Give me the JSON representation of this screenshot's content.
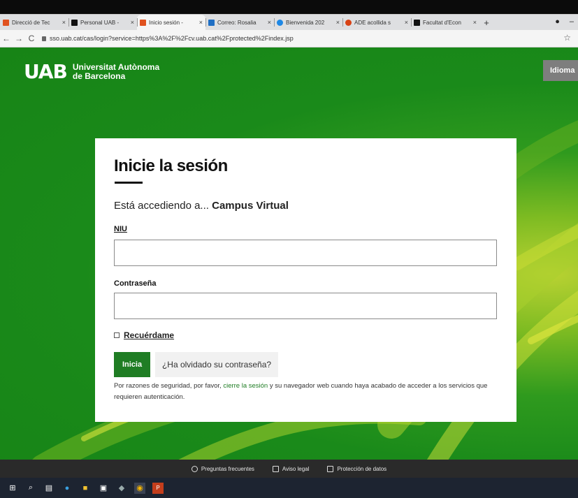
{
  "browser": {
    "tabs": [
      {
        "title": "Direcció de Tec",
        "favicon_color": "#e0521f"
      },
      {
        "title": "Personal UAB -",
        "favicon_color": "#111111"
      },
      {
        "title": "Inicio sesión - ",
        "favicon_color": "#e0521f",
        "active": true
      },
      {
        "title": "Correo: Rosalia",
        "favicon_color": "#1f6fc4"
      },
      {
        "title": "Bienvenida 202",
        "favicon_color": "#1e88e5"
      },
      {
        "title": "ADE acollida s",
        "favicon_color": "#d84315"
      },
      {
        "title": "Facultat d'Econ",
        "favicon_color": "#111111"
      }
    ],
    "tab_close": "×",
    "new_tab": "+",
    "url": "sso.uab.cat/cas/login?service=https%3A%2F%2Fcv.uab.cat%2Fprotected%2Findex.jsp"
  },
  "header": {
    "logo_text": "UAB",
    "university_line1": "Universitat Autònoma",
    "university_line2": "de Barcelona",
    "language_button": "Idioma"
  },
  "login": {
    "title": "Inicie la sesión",
    "access_prefix": "Está accediendo a...",
    "access_service": "Campus Virtual",
    "niu_label": "NIU",
    "niu_value": "",
    "password_label": "Contraseña",
    "password_value": "",
    "remember_label": "Recuérdame",
    "login_button": "Inicia",
    "forgot_button": "¿Ha olvidado su contraseña?",
    "notice_before": "Por razones de seguridad, por favor, ",
    "notice_link": "cierre la sesión",
    "notice_after": " y su navegador web cuando haya acabado de acceder a los servicios que requieren autenticación."
  },
  "footer": {
    "faq": "Preguntas frecuentes",
    "legal": "Aviso legal",
    "privacy": "Protección de datos"
  },
  "colors": {
    "brand_green": "#1f7d24",
    "background_green": "#178416",
    "footer_bg": "#2a2a2a",
    "taskbar_bg": "#1d2431"
  }
}
